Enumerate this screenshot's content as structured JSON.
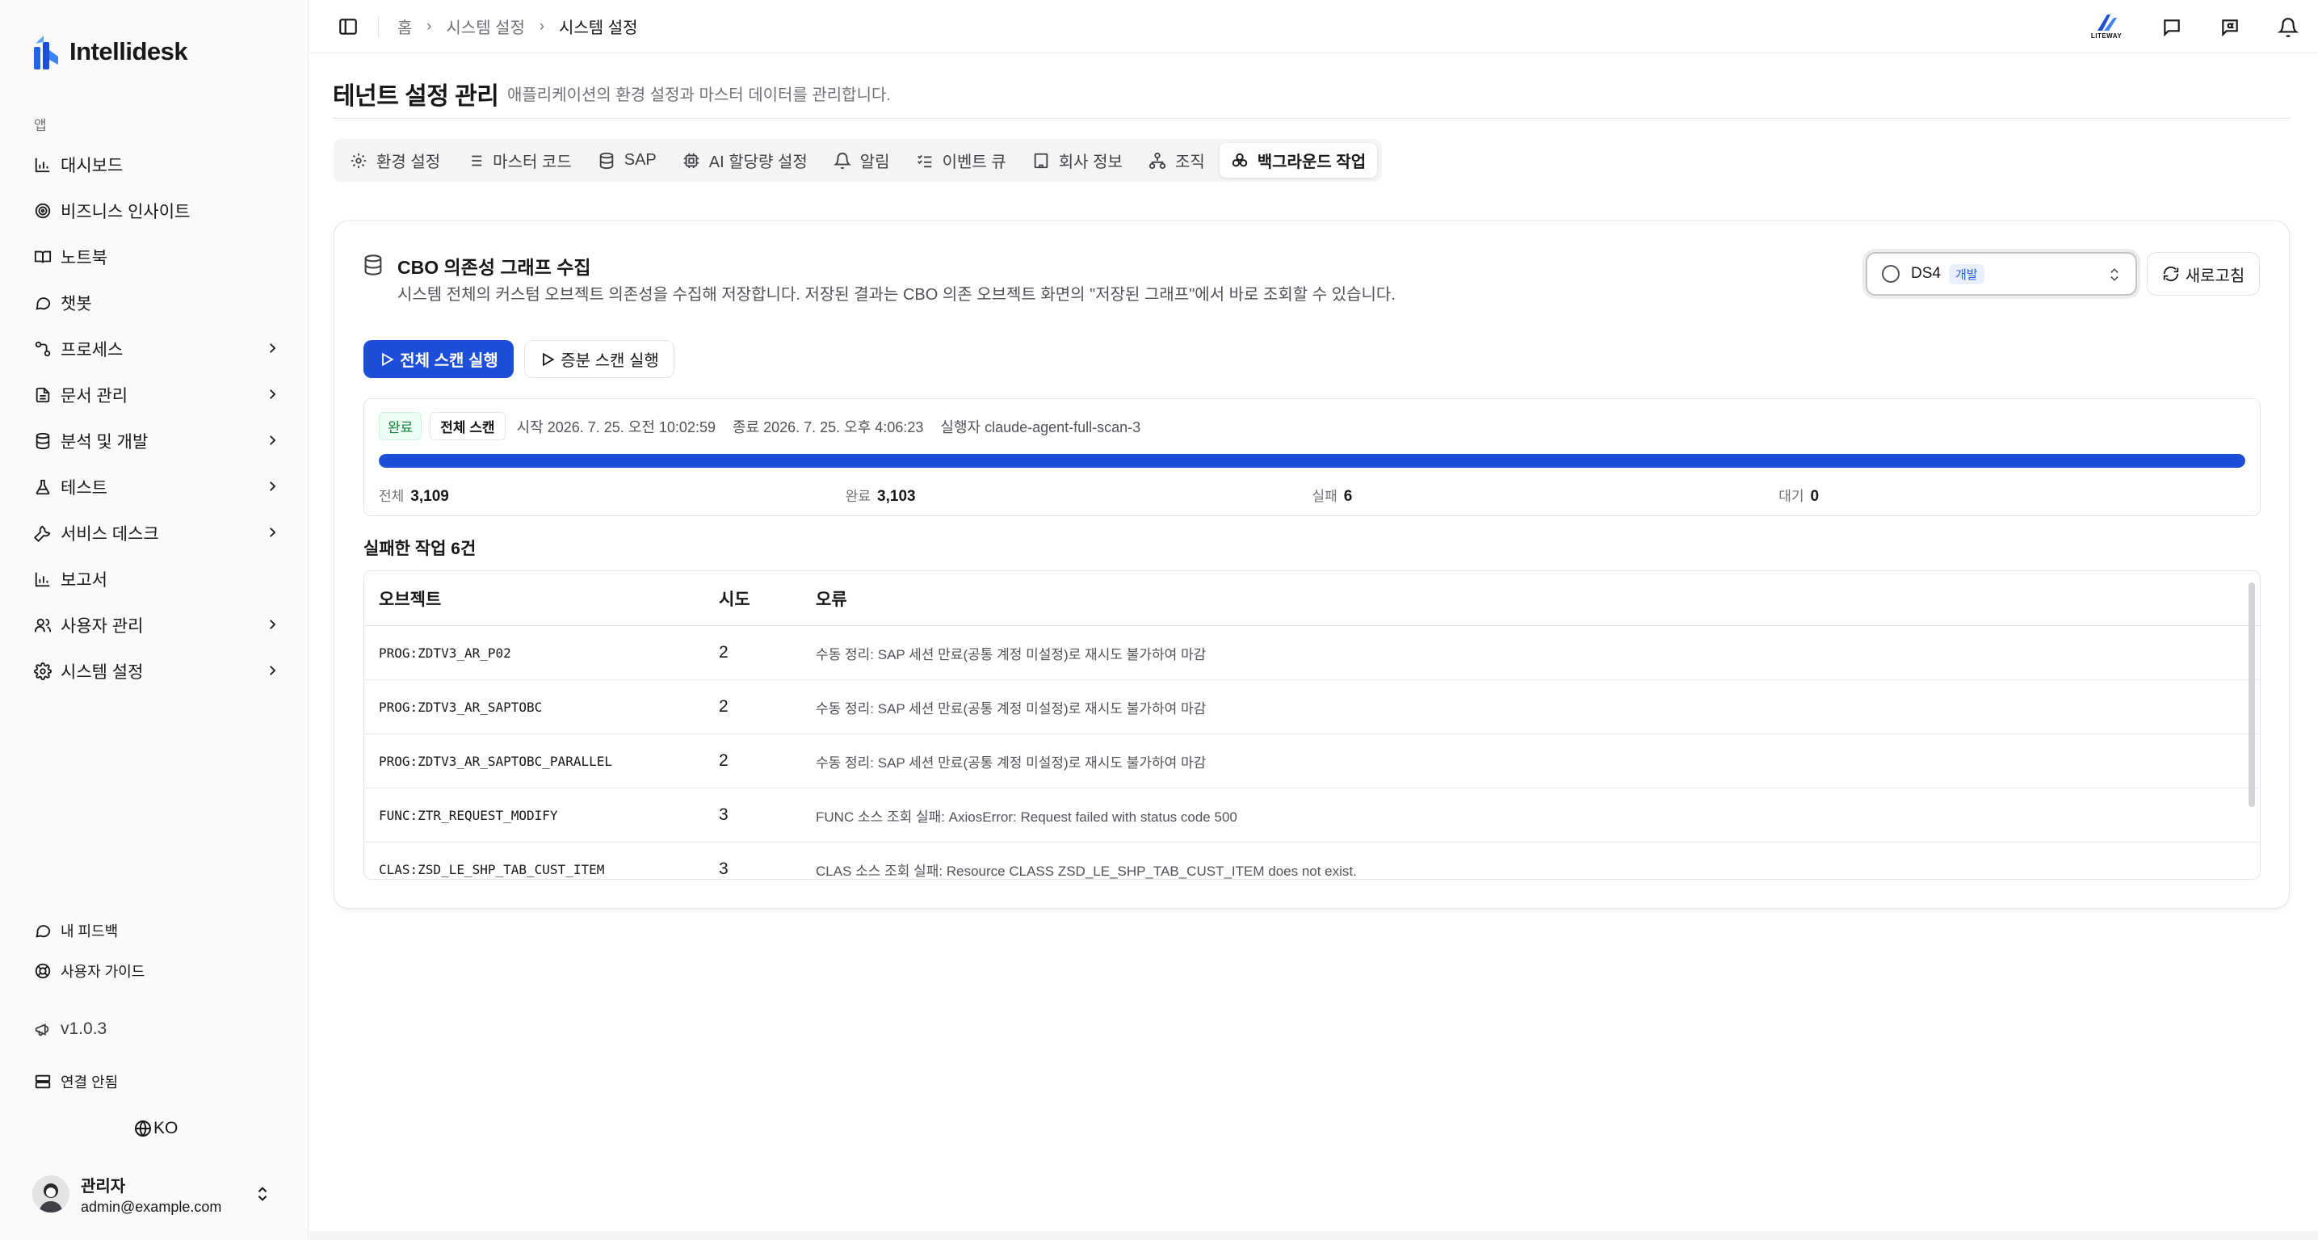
{
  "app": {
    "name": "Intellidesk",
    "brand_color": "#2563eb"
  },
  "sidebar": {
    "section_label": "앱",
    "items": [
      {
        "label": "대시보드",
        "icon": "bar-chart-icon",
        "has_children": false
      },
      {
        "label": "비즈니스 인사이트",
        "icon": "target-icon",
        "has_children": false
      },
      {
        "label": "노트북",
        "icon": "book-icon",
        "has_children": false
      },
      {
        "label": "챗봇",
        "icon": "chat-icon",
        "has_children": false
      },
      {
        "label": "프로세스",
        "icon": "workflow-icon",
        "has_children": true
      },
      {
        "label": "문서 관리",
        "icon": "document-icon",
        "has_children": true
      },
      {
        "label": "분석 및 개발",
        "icon": "database-icon",
        "has_children": true
      },
      {
        "label": "테스트",
        "icon": "flask-icon",
        "has_children": true
      },
      {
        "label": "서비스 데스크",
        "icon": "wrench-icon",
        "has_children": true
      },
      {
        "label": "보고서",
        "icon": "bar-chart-icon",
        "has_children": false
      },
      {
        "label": "사용자 관리",
        "icon": "users-icon",
        "has_children": true
      },
      {
        "label": "시스템 설정",
        "icon": "gear-icon",
        "has_children": true
      }
    ],
    "feedback_label": "내 피드백",
    "guide_label": "사용자 가이드",
    "version": "v1.0.3",
    "connection_label": "연결 안됨",
    "language": "KO",
    "user": {
      "name": "관리자",
      "email": "admin@example.com"
    }
  },
  "topbar": {
    "breadcrumb": [
      "홈",
      "시스템 설정",
      "시스템 설정"
    ],
    "partner_logo_text": "LITEWAY"
  },
  "page": {
    "title": "테넌트 설정 관리",
    "description": "애플리케이션의 환경 설정과 마스터 데이터를 관리합니다."
  },
  "tabs": [
    {
      "label": "환경 설정",
      "icon": "gear-icon",
      "active": false
    },
    {
      "label": "마스터 코드",
      "icon": "list-icon",
      "active": false
    },
    {
      "label": "SAP",
      "icon": "database-icon",
      "active": false
    },
    {
      "label": "AI 할당량 설정",
      "icon": "cpu-icon",
      "active": false
    },
    {
      "label": "알림",
      "icon": "bell-icon",
      "active": false
    },
    {
      "label": "이벤트 큐",
      "icon": "list-checks-icon",
      "active": false
    },
    {
      "label": "회사 정보",
      "icon": "building-icon",
      "active": false
    },
    {
      "label": "조직",
      "icon": "org-chart-icon",
      "active": false
    },
    {
      "label": "백그라운드 작업",
      "icon": "jobs-icon",
      "active": true
    }
  ],
  "card": {
    "title": "CBO 의존성 그래프 수집",
    "description": "시스템 전체의 커스텀 오브젝트 의존성을 수집해 저장합니다. 저장된 결과는 CBO 의존 오브젝트 화면의 \"저장된 그래프\"에서 바로 조회할 수 있습니다.",
    "system_select": {
      "value": "DS4",
      "badge": "개발"
    },
    "refresh_label": "새로고침",
    "full_scan_label": "전체 스캔 실행",
    "incremental_scan_label": "증분 스캔 실행"
  },
  "status": {
    "state": "완료",
    "scan_type": "전체 스캔",
    "start": "시작 2026. 7. 25. 오전 10:02:59",
    "end": "종료 2026. 7. 25. 오후 4:06:23",
    "runner": "실행자 claude-agent-full-scan-3",
    "progress_percent": 100,
    "stats": [
      {
        "label": "전체",
        "value": "3,109"
      },
      {
        "label": "완료",
        "value": "3,103"
      },
      {
        "label": "실패",
        "value": "6"
      },
      {
        "label": "대기",
        "value": "0"
      }
    ]
  },
  "failed": {
    "title": "실패한 작업 6건",
    "columns": [
      "오브젝트",
      "시도",
      "오류"
    ],
    "rows": [
      {
        "object": "PROG:ZDTV3_AR_P02",
        "attempts": "2",
        "error": "수동 정리: SAP 세션 만료(공통 계정 미설정)로 재시도 불가하여 마감"
      },
      {
        "object": "PROG:ZDTV3_AR_SAPTOBC",
        "attempts": "2",
        "error": "수동 정리: SAP 세션 만료(공통 계정 미설정)로 재시도 불가하여 마감"
      },
      {
        "object": "PROG:ZDTV3_AR_SAPTOBC_PARALLEL",
        "attempts": "2",
        "error": "수동 정리: SAP 세션 만료(공통 계정 미설정)로 재시도 불가하여 마감"
      },
      {
        "object": "FUNC:ZTR_REQUEST_MODIFY",
        "attempts": "3",
        "error": "FUNC 소스 조회 실패: AxiosError: Request failed with status code 500"
      },
      {
        "object": "CLAS:ZSD_LE_SHP_TAB_CUST_ITEM",
        "attempts": "3",
        "error": "CLAS 소스 조회 실패: Resource CLASS ZSD_LE_SHP_TAB_CUST_ITEM does not exist."
      }
    ]
  }
}
